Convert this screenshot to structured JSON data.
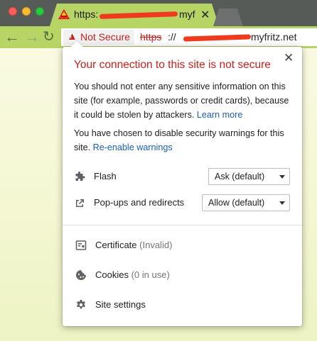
{
  "tab": {
    "title": "https:",
    "title_tail": "myf",
    "close_glyph": "✕"
  },
  "toolbar": {
    "back_glyph": "←",
    "forward_glyph": "→",
    "reload_glyph": "↻"
  },
  "omnibox": {
    "security_label": "Not Secure",
    "url_scheme": "https",
    "url_visible_tail": "myfritz.net"
  },
  "popup": {
    "heading": "Your connection to this site is not secure",
    "paragraph1": "You should not enter any sensitive information on this site (for example, passwords or credit cards), because it could be stolen by attackers.",
    "paragraph1_link": "Learn more",
    "paragraph2": "You have chosen to disable security warnings for this site.",
    "paragraph2_link": "Re-enable warnings",
    "close_glyph": "✕",
    "permissions": [
      {
        "label": "Flash",
        "value": "Ask (default)",
        "icon": "puzzle-icon"
      },
      {
        "label": "Pop-ups and redirects",
        "value": "Allow (default)",
        "icon": "open-in-new-icon"
      }
    ],
    "menu": [
      {
        "label": "Certificate",
        "sub": "(Invalid)",
        "icon": "certificate-icon"
      },
      {
        "label": "Cookies",
        "sub": "(0 in use)",
        "icon": "cookie-icon"
      },
      {
        "label": "Site settings",
        "sub": "",
        "icon": "gear-icon"
      }
    ]
  },
  "colors": {
    "tab_bar": "#575b58",
    "theme_green": "#b7d565",
    "danger_red": "#c5221f",
    "link_blue": "#1a5fb4"
  }
}
